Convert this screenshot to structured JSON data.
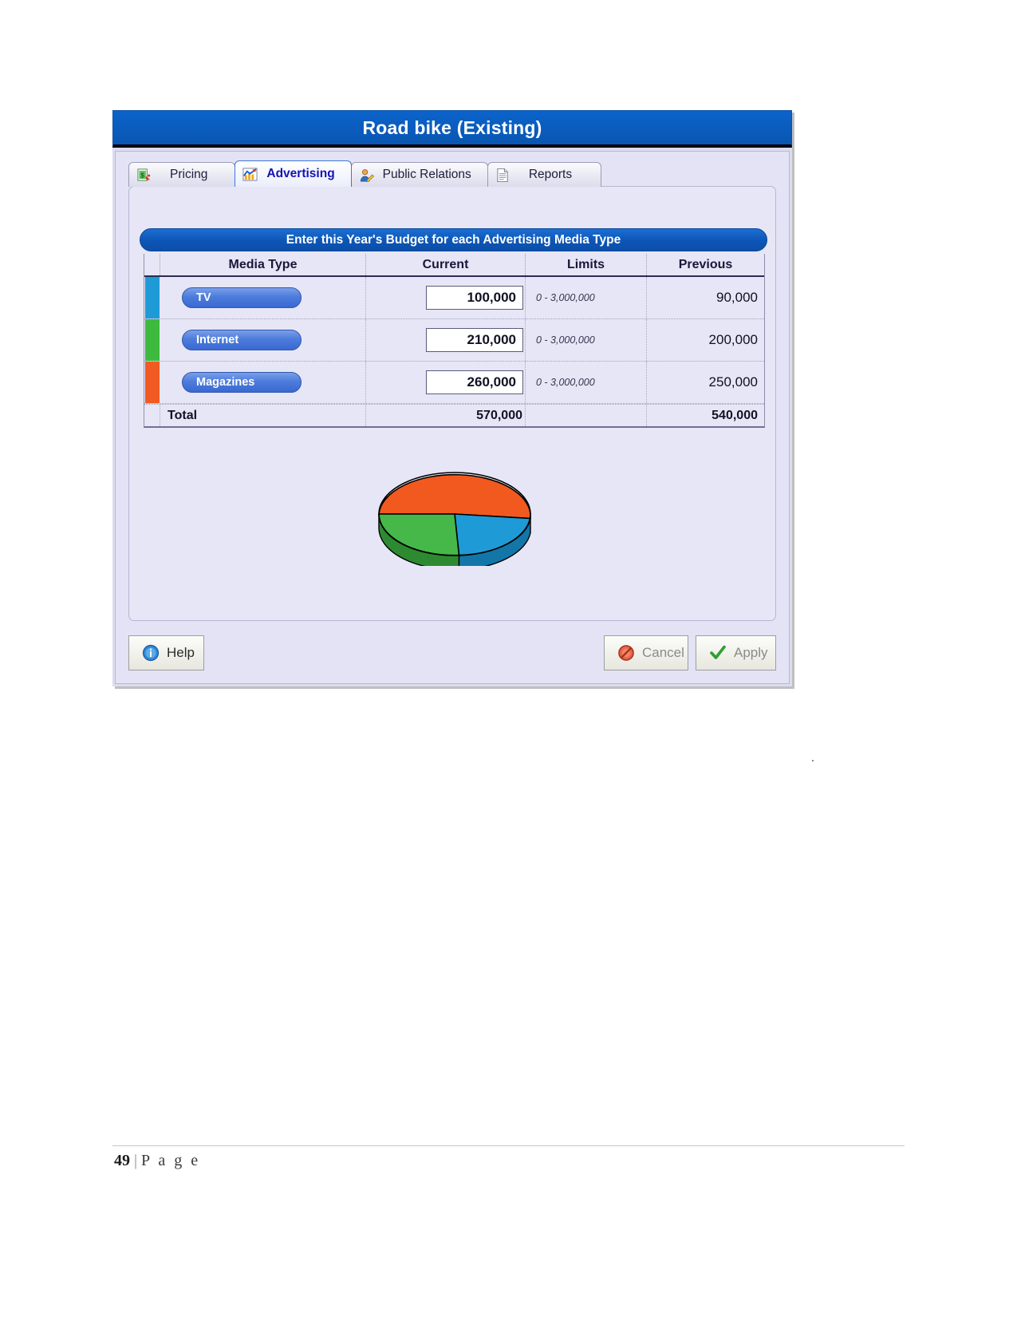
{
  "window": {
    "title": "Road bike (Existing)"
  },
  "tabs": [
    {
      "id": "pricing",
      "label": "Pricing",
      "icon": "pricing-tag-icon",
      "active": false
    },
    {
      "id": "advertising",
      "label": "Advertising",
      "icon": "chart-up-icon",
      "active": true
    },
    {
      "id": "public-relations",
      "label": "Public Relations",
      "icon": "person-pencil-icon",
      "active": false
    },
    {
      "id": "reports",
      "label": "Reports",
      "icon": "document-icon",
      "active": false
    }
  ],
  "banner": {
    "text": "Enter this Year's Budget for each Advertising Media Type"
  },
  "table": {
    "headers": {
      "media_type": "Media Type",
      "current": "Current",
      "limits": "Limits",
      "previous": "Previous"
    },
    "rows": [
      {
        "media": "TV",
        "current": "100,000",
        "limits": "0 - 3,000,000",
        "previous": "90,000",
        "color": "#1e9bd7"
      },
      {
        "media": "Internet",
        "current": "210,000",
        "limits": "0 - 3,000,000",
        "previous": "200,000",
        "color": "#3dba3d"
      },
      {
        "media": "Magazines",
        "current": "260,000",
        "limits": "0 - 3,000,000",
        "previous": "250,000",
        "color": "#f15a22"
      }
    ],
    "total": {
      "label": "Total",
      "current": "570,000",
      "limits": "",
      "previous": "540,000"
    }
  },
  "chart_data": {
    "type": "pie",
    "title": "",
    "categories": [
      "TV",
      "Internet",
      "Magazines"
    ],
    "values": [
      100000,
      210000,
      260000
    ],
    "percentages": [
      17.5,
      36.8,
      45.6
    ],
    "colors": [
      "#1e9bd7",
      "#45b849",
      "#f1591f"
    ],
    "side_colors": [
      "#1276a8",
      "#2e8a31",
      "#c2400f"
    ],
    "legend": "none",
    "style": "3d-pie"
  },
  "buttons": {
    "help": {
      "label": "Help",
      "icon": "info-icon"
    },
    "cancel": {
      "label": "Cancel",
      "icon": "no-entry-icon"
    },
    "apply": {
      "label": "Apply",
      "icon": "check-icon"
    }
  },
  "page_footer": {
    "number": "49",
    "separator": "|",
    "word": "P a g e"
  }
}
